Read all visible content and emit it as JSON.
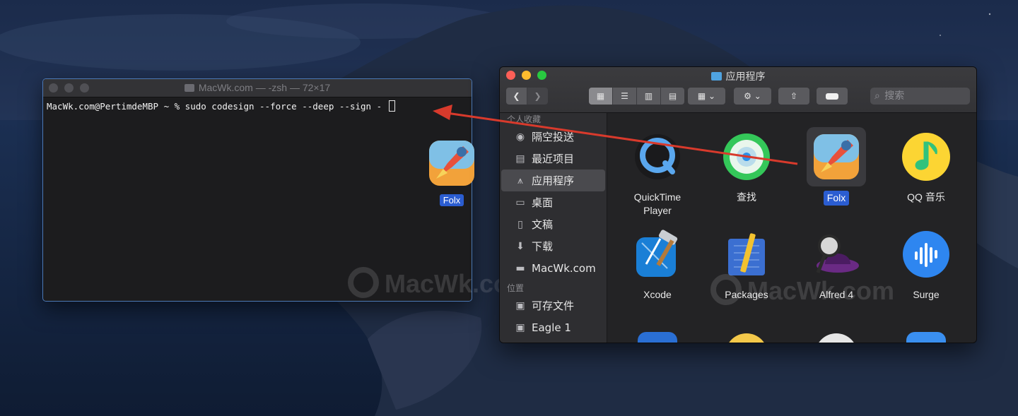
{
  "terminal": {
    "title": "MacWk.com — -zsh — 72×17",
    "prompt_line": "MacWk.com@PertimdeMBP ~ % sudo codesign --force --deep --sign - "
  },
  "desktop": {
    "icon_label": "Folx",
    "watermark": "MacWk.com"
  },
  "finder": {
    "title": "应用程序",
    "search_placeholder": "搜索",
    "sidebar": {
      "favorites_header": "个人收藏",
      "favorites": [
        {
          "label": "隔空投送",
          "icon": "airdrop-icon"
        },
        {
          "label": "最近项目",
          "icon": "recents-icon"
        },
        {
          "label": "应用程序",
          "icon": "applications-icon",
          "selected": true
        },
        {
          "label": "桌面",
          "icon": "desktop-icon"
        },
        {
          "label": "文稿",
          "icon": "documents-icon"
        },
        {
          "label": "下载",
          "icon": "downloads-icon"
        },
        {
          "label": "MacWk.com",
          "icon": "folder-icon"
        }
      ],
      "locations_header": "位置",
      "locations": [
        {
          "label": "可存文件",
          "icon": "disk-icon"
        },
        {
          "label": "Eagle 1",
          "icon": "disk-icon"
        }
      ]
    },
    "apps": [
      {
        "name": "QuickTime Player",
        "line1": "QuickTime",
        "line2": "Player",
        "icon": "quicktime-icon"
      },
      {
        "name": "查找",
        "line1": "查找",
        "line2": "",
        "icon": "findmy-icon"
      },
      {
        "name": "Folx",
        "line1": "Folx",
        "line2": "",
        "icon": "folx-rocket-icon",
        "selected": true
      },
      {
        "name": "QQ 音乐",
        "line1": "QQ 音乐",
        "line2": "",
        "icon": "qqmusic-icon"
      },
      {
        "name": "Xcode",
        "line1": "Xcode",
        "line2": "",
        "icon": "xcode-icon"
      },
      {
        "name": "Packages",
        "line1": "Packages",
        "line2": "",
        "icon": "packages-icon"
      },
      {
        "name": "Alfred 4",
        "line1": "Alfred 4",
        "line2": "",
        "icon": "alfred-icon"
      },
      {
        "name": "Surge",
        "line1": "Surge",
        "line2": "",
        "icon": "surge-icon"
      }
    ],
    "watermark": "MacWk.com"
  },
  "colors": {
    "accent": "#2b5dd1",
    "arrow": "#d83a2c",
    "traffic_red": "#fe5f57",
    "traffic_yellow": "#febc2e",
    "traffic_green": "#28c840"
  }
}
